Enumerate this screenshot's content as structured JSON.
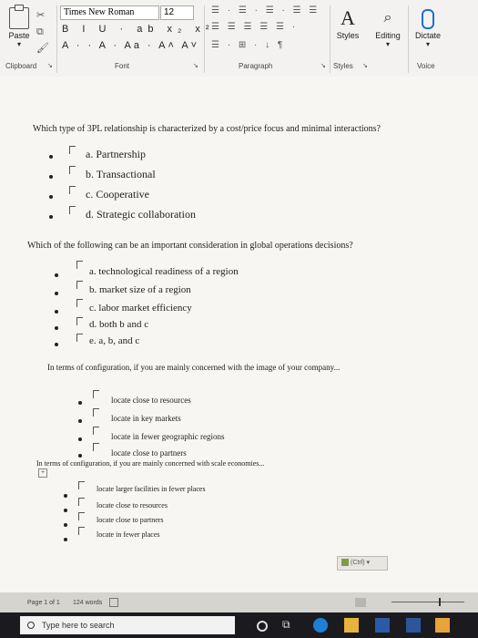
{
  "ribbon": {
    "font_name": "Times New Roman",
    "font_size": "12",
    "paste_label": "Paste",
    "styles_label": "Styles",
    "editing_label": "Editing",
    "dictate_label": "Dictate",
    "font_row1": "B I U · ab x₂ x²",
    "font_row2": "A · · A · Aa · A˄ A˅",
    "para_row1": "☰ · ☰ · ☰ ·  ☰ ☰",
    "para_row2": "☰ ☰ ☰ ☰  ☰ ·",
    "para_row3": "☰ · ⊞ ·  ↓ ¶",
    "groups": {
      "clipboard": "Clipboard",
      "font": "Font",
      "paragraph": "Paragraph",
      "styles": "Styles",
      "voice": "Voice"
    }
  },
  "doc": {
    "q1": {
      "text": "Which type of 3PL relationship is characterized by a cost/price focus and minimal interactions?",
      "options": [
        "a. Partnership",
        "b. Transactional",
        "c. Cooperative",
        "d. Strategic collaboration"
      ]
    },
    "q2": {
      "text": "Which of the following can be an important consideration in global operations decisions?",
      "options": [
        "a. technological readiness of a region",
        "b. market size of a region",
        "c. labor market efficiency",
        "d. both b and c",
        "e. a, b, and c"
      ]
    },
    "q3": {
      "text": "In terms of configuration, if you are mainly concerned with the image of your company...",
      "options": [
        "locate close to resources",
        "locate in key markets",
        "locate in fewer geographic regions",
        "locate close to partners"
      ]
    },
    "q4": {
      "text": "In terms of configuration, if you are mainly concerned with scale economies...",
      "options": [
        "locate larger facilities in fewer places",
        "locate close to resources",
        "locate close to partners",
        "locate in fewer places"
      ]
    },
    "paste_options": "(Ctrl) ▾"
  },
  "status": {
    "page": "Page 1 of 1",
    "words": "124 words"
  },
  "taskbar": {
    "search_placeholder": "Type here to search"
  }
}
